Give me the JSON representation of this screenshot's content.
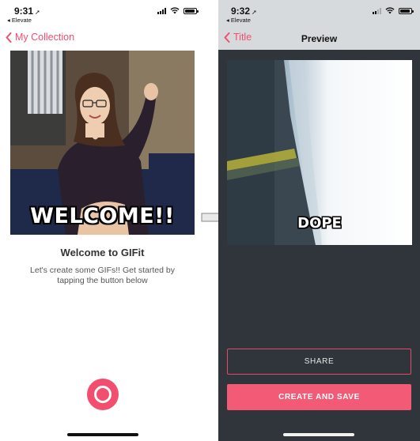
{
  "left_screen": {
    "status": {
      "time": "9:31",
      "back_app": "◂ Elevate"
    },
    "nav": {
      "back_label": "My Collection"
    },
    "gif": {
      "caption": "WELCOME!!"
    },
    "welcome": {
      "title": "Welcome to GIFit",
      "body": "Let's create some GIFs!! Get started by tapping the button below"
    }
  },
  "right_screen": {
    "status": {
      "time": "9:32",
      "back_app": "◂ Elevate"
    },
    "nav": {
      "back_label": "Title",
      "title": "Preview"
    },
    "gif": {
      "caption": "DOPE"
    },
    "actions": {
      "share_label": "SHARE",
      "create_label": "CREATE AND SAVE"
    }
  },
  "colors": {
    "accent": "#f24e6d",
    "preview_background": "#2f353b",
    "nav_background_right": "#d7dadd"
  },
  "icons": [
    "location-arrow-icon",
    "chevron-left-icon",
    "signal-icon",
    "wifi-icon",
    "battery-icon",
    "record-icon",
    "right-arrow-icon"
  ]
}
